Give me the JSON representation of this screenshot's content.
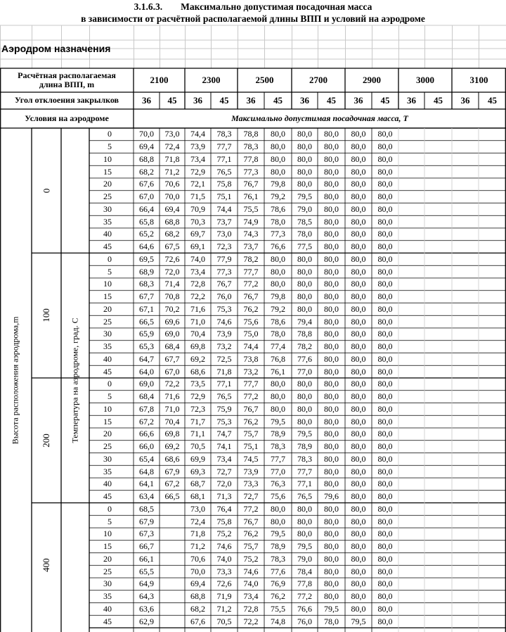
{
  "title": {
    "number": "3.1.6.3.",
    "line1": "Максимально допустимая посадочная масса",
    "line2": "в зависимости от расчётной располагаемой длины ВПП и условий на аэродроме"
  },
  "section_label": "Аэродром назначения",
  "header": {
    "runway_label_1": "Расчётная располагаемая",
    "runway_label_2": "длина ВПП, m",
    "runway_lengths": [
      "2100",
      "2300",
      "2500",
      "2700",
      "2900",
      "3000",
      "3100"
    ],
    "flap_label": "Угол отклоения закрылков",
    "flap_angles": [
      "36",
      "45",
      "36",
      "45",
      "36",
      "45",
      "36",
      "45",
      "36",
      "45",
      "36",
      "45",
      "36",
      "45"
    ],
    "conditions_label": "Условия на аэродроме",
    "mass_label": "Максимально допустимая посадочная масса, Т"
  },
  "axis": {
    "elevation_label": "Высота расположения аэродрома,m",
    "temperature_label": "Температура на аэродроме, град. С"
  },
  "groups": [
    {
      "elevation": "0",
      "rows": [
        {
          "temp": "0",
          "v": [
            "70,0",
            "73,0",
            "74,4",
            "78,3",
            "78,8",
            "80,0",
            "80,0",
            "80,0",
            "80,0",
            "80,0"
          ]
        },
        {
          "temp": "5",
          "v": [
            "69,4",
            "72,4",
            "73,9",
            "77,7",
            "78,3",
            "80,0",
            "80,0",
            "80,0",
            "80,0",
            "80,0"
          ]
        },
        {
          "temp": "10",
          "v": [
            "68,8",
            "71,8",
            "73,4",
            "77,1",
            "77,8",
            "80,0",
            "80,0",
            "80,0",
            "80,0",
            "80,0"
          ]
        },
        {
          "temp": "15",
          "v": [
            "68,2",
            "71,2",
            "72,9",
            "76,5",
            "77,3",
            "80,0",
            "80,0",
            "80,0",
            "80,0",
            "80,0"
          ]
        },
        {
          "temp": "20",
          "v": [
            "67,6",
            "70,6",
            "72,1",
            "75,8",
            "76,7",
            "79,8",
            "80,0",
            "80,0",
            "80,0",
            "80,0"
          ]
        },
        {
          "temp": "25",
          "v": [
            "67,0",
            "70,0",
            "71,5",
            "75,1",
            "76,1",
            "79,2",
            "79,5",
            "80,0",
            "80,0",
            "80,0"
          ]
        },
        {
          "temp": "30",
          "v": [
            "66,4",
            "69,4",
            "70,9",
            "74,4",
            "75,5",
            "78,6",
            "79,0",
            "80,0",
            "80,0",
            "80,0"
          ]
        },
        {
          "temp": "35",
          "v": [
            "65,8",
            "68,8",
            "70,3",
            "73,7",
            "74,9",
            "78,0",
            "78,5",
            "80,0",
            "80,0",
            "80,0"
          ]
        },
        {
          "temp": "40",
          "v": [
            "65,2",
            "68,2",
            "69,7",
            "73,0",
            "74,3",
            "77,3",
            "78,0",
            "80,0",
            "80,0",
            "80,0"
          ]
        },
        {
          "temp": "45",
          "v": [
            "64,6",
            "67,5",
            "69,1",
            "72,3",
            "73,7",
            "76,6",
            "77,5",
            "80,0",
            "80,0",
            "80,0"
          ]
        }
      ]
    },
    {
      "elevation": "100",
      "rows": [
        {
          "temp": "0",
          "v": [
            "69,5",
            "72,6",
            "74,0",
            "77,9",
            "78,2",
            "80,0",
            "80,0",
            "80,0",
            "80,0",
            "80,0"
          ]
        },
        {
          "temp": "5",
          "v": [
            "68,9",
            "72,0",
            "73,4",
            "77,3",
            "77,7",
            "80,0",
            "80,0",
            "80,0",
            "80,0",
            "80,0"
          ]
        },
        {
          "temp": "10",
          "v": [
            "68,3",
            "71,4",
            "72,8",
            "76,7",
            "77,2",
            "80,0",
            "80,0",
            "80,0",
            "80,0",
            "80,0"
          ]
        },
        {
          "temp": "15",
          "v": [
            "67,7",
            "70,8",
            "72,2",
            "76,0",
            "76,7",
            "79,8",
            "80,0",
            "80,0",
            "80,0",
            "80,0"
          ]
        },
        {
          "temp": "20",
          "v": [
            "67,1",
            "70,2",
            "71,6",
            "75,3",
            "76,2",
            "79,2",
            "80,0",
            "80,0",
            "80,0",
            "80,0"
          ]
        },
        {
          "temp": "25",
          "v": [
            "66,5",
            "69,6",
            "71,0",
            "74,6",
            "75,6",
            "78,6",
            "79,4",
            "80,0",
            "80,0",
            "80,0"
          ]
        },
        {
          "temp": "30",
          "v": [
            "65,9",
            "69,0",
            "70,4",
            "73,9",
            "75,0",
            "78,0",
            "78,8",
            "80,0",
            "80,0",
            "80,0"
          ]
        },
        {
          "temp": "35",
          "v": [
            "65,3",
            "68,4",
            "69,8",
            "73,2",
            "74,4",
            "77,4",
            "78,2",
            "80,0",
            "80,0",
            "80,0"
          ]
        },
        {
          "temp": "40",
          "v": [
            "64,7",
            "67,7",
            "69,2",
            "72,5",
            "73,8",
            "76,8",
            "77,6",
            "80,0",
            "80,0",
            "80,0"
          ]
        },
        {
          "temp": "45",
          "v": [
            "64,0",
            "67,0",
            "68,6",
            "71,8",
            "73,2",
            "76,1",
            "77,0",
            "80,0",
            "80,0",
            "80,0"
          ]
        }
      ]
    },
    {
      "elevation": "200",
      "rows": [
        {
          "temp": "0",
          "v": [
            "69,0",
            "72,2",
            "73,5",
            "77,1",
            "77,7",
            "80,0",
            "80,0",
            "80,0",
            "80,0",
            "80,0"
          ]
        },
        {
          "temp": "5",
          "v": [
            "68,4",
            "71,6",
            "72,9",
            "76,5",
            "77,2",
            "80,0",
            "80,0",
            "80,0",
            "80,0",
            "80,0"
          ]
        },
        {
          "temp": "10",
          "v": [
            "67,8",
            "71,0",
            "72,3",
            "75,9",
            "76,7",
            "80,0",
            "80,0",
            "80,0",
            "80,0",
            "80,0"
          ]
        },
        {
          "temp": "15",
          "v": [
            "67,2",
            "70,4",
            "71,7",
            "75,3",
            "76,2",
            "79,5",
            "80,0",
            "80,0",
            "80,0",
            "80,0"
          ]
        },
        {
          "temp": "20",
          "v": [
            "66,6",
            "69,8",
            "71,1",
            "74,7",
            "75,7",
            "78,9",
            "79,5",
            "80,0",
            "80,0",
            "80,0"
          ]
        },
        {
          "temp": "25",
          "v": [
            "66,0",
            "69,2",
            "70,5",
            "74,1",
            "75,1",
            "78,3",
            "78,9",
            "80,0",
            "80,0",
            "80,0"
          ]
        },
        {
          "temp": "30",
          "v": [
            "65,4",
            "68,6",
            "69,9",
            "73,4",
            "74,5",
            "77,7",
            "78,3",
            "80,0",
            "80,0",
            "80,0"
          ]
        },
        {
          "temp": "35",
          "v": [
            "64,8",
            "67,9",
            "69,3",
            "72,7",
            "73,9",
            "77,0",
            "77,7",
            "80,0",
            "80,0",
            "80,0"
          ]
        },
        {
          "temp": "40",
          "v": [
            "64,1",
            "67,2",
            "68,7",
            "72,0",
            "73,3",
            "76,3",
            "77,1",
            "80,0",
            "80,0",
            "80,0"
          ]
        },
        {
          "temp": "45",
          "v": [
            "63,4",
            "66,5",
            "68,1",
            "71,3",
            "72,7",
            "75,6",
            "76,5",
            "79,6",
            "80,0",
            "80,0"
          ]
        }
      ]
    },
    {
      "elevation": "400",
      "rows": [
        {
          "temp": "0",
          "v": [
            "68,5",
            "",
            "73,0",
            "76,4",
            "77,2",
            "80,0",
            "80,0",
            "80,0",
            "80,0",
            "80,0"
          ]
        },
        {
          "temp": "5",
          "v": [
            "67,9",
            "",
            "72,4",
            "75,8",
            "76,7",
            "80,0",
            "80,0",
            "80,0",
            "80,0",
            "80,0"
          ]
        },
        {
          "temp": "10",
          "v": [
            "67,3",
            "",
            "71,8",
            "75,2",
            "76,2",
            "79,5",
            "80,0",
            "80,0",
            "80,0",
            "80,0"
          ]
        },
        {
          "temp": "15",
          "v": [
            "66,7",
            "",
            "71,2",
            "74,6",
            "75,7",
            "78,9",
            "79,5",
            "80,0",
            "80,0",
            "80,0"
          ]
        },
        {
          "temp": "20",
          "v": [
            "66,1",
            "",
            "70,6",
            "74,0",
            "75,2",
            "78,3",
            "79,0",
            "80,0",
            "80,0",
            "80,0"
          ]
        },
        {
          "temp": "25",
          "v": [
            "65,5",
            "",
            "70,0",
            "73,3",
            "74,6",
            "77,6",
            "78,4",
            "80,0",
            "80,0",
            "80,0"
          ]
        },
        {
          "temp": "30",
          "v": [
            "64,9",
            "",
            "69,4",
            "72,6",
            "74,0",
            "76,9",
            "77,8",
            "80,0",
            "80,0",
            "80,0"
          ]
        },
        {
          "temp": "35",
          "v": [
            "64,3",
            "",
            "68,8",
            "71,9",
            "73,4",
            "76,2",
            "77,2",
            "80,0",
            "80,0",
            "80,0"
          ]
        },
        {
          "temp": "40",
          "v": [
            "63,6",
            "",
            "68,2",
            "71,2",
            "72,8",
            "75,5",
            "76,6",
            "79,5",
            "80,0",
            "80,0"
          ]
        },
        {
          "temp": "45",
          "v": [
            "62,9",
            "",
            "67,6",
            "70,5",
            "72,2",
            "74,8",
            "76,0",
            "78,0",
            "79,5",
            "80,0"
          ]
        }
      ]
    }
  ]
}
